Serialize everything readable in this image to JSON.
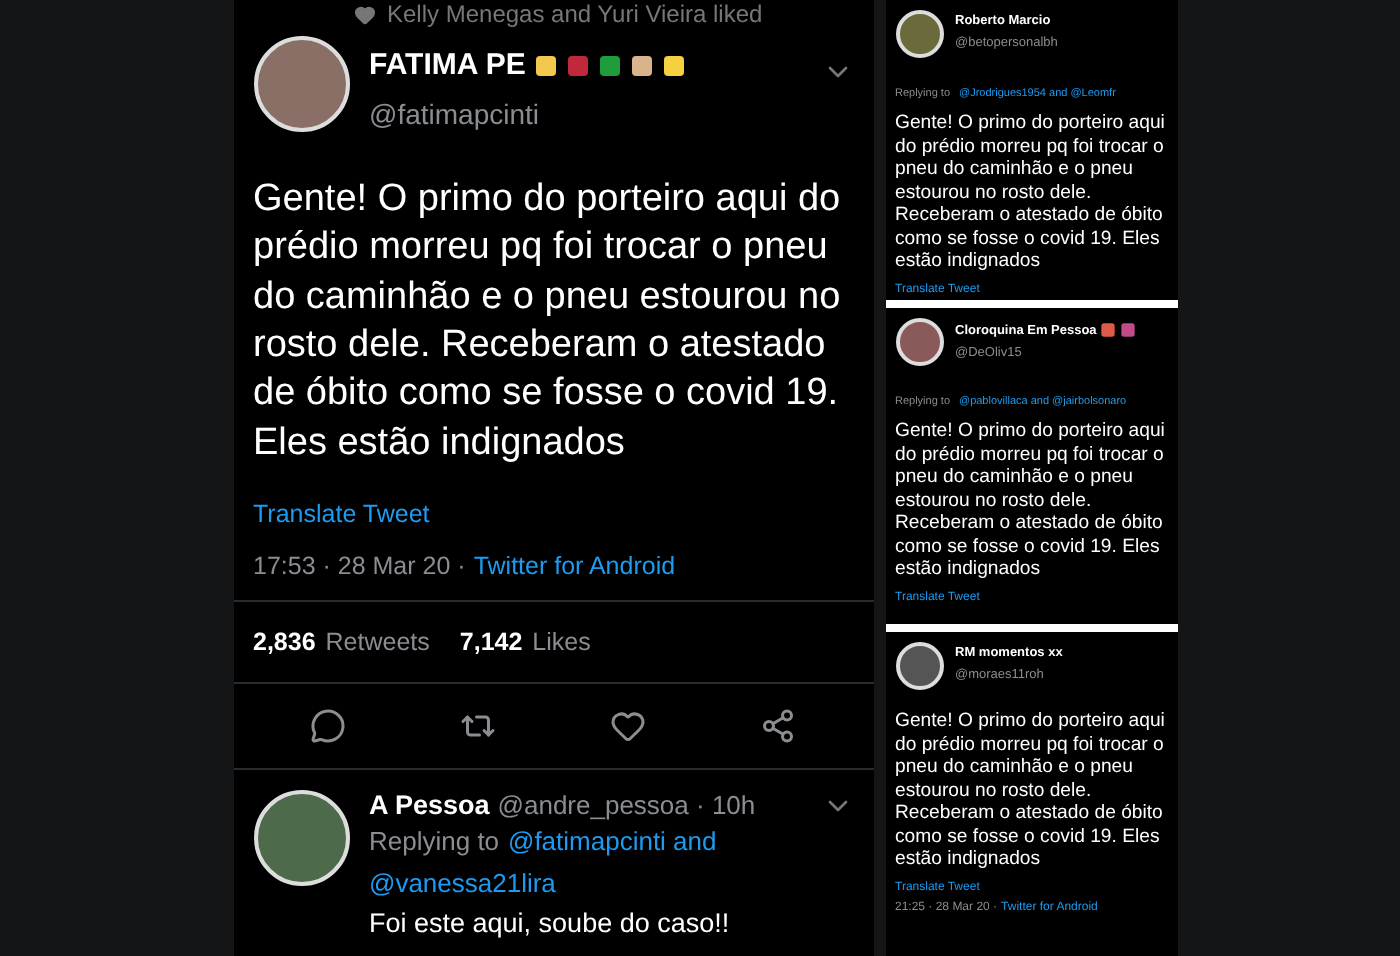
{
  "liked_banner": "Kelly Menegas and Yuri Vieira liked",
  "main_tweet": {
    "author": "FATIMA PE",
    "handle": "@fatimapcinti",
    "text": "Gente! O primo do porteiro aqui do prédio morreu pq foi trocar o pneu do caminhão e o pneu estourou no rosto dele. Receberam o atestado de óbito como se fosse o covid 19. Eles estão indignados",
    "translate": "Translate Tweet",
    "time": "17:53 · 28 Mar 20 ·",
    "source": "Twitter for Android",
    "retweets_count": "2,836",
    "retweets_label": "Retweets",
    "likes_count": "7,142",
    "likes_label": "Likes"
  },
  "reply": {
    "author": "A Pessoa",
    "handle": "@andre_pessoa · 10h",
    "replying_label": "Replying to",
    "replying_to": "@fatimapcinti and",
    "replying_to_cont": "@vanessa21lira",
    "text": "Foi este aqui, soube do caso!!"
  },
  "side_tweets": [
    {
      "author": "Roberto Marcio",
      "handle": "@betopersonalbh",
      "replying_label": "Replying to",
      "replying_to": "@Jrodrigues1954 and @Leomfr",
      "text": "Gente! O primo do porteiro aqui do prédio morreu pq foi trocar o pneu do caminhão e o pneu estourou no rosto dele. Receberam o atestado de óbito como se fosse o covid 19. Eles estão indignados",
      "translate": "Translate Tweet"
    },
    {
      "author": "Cloroquina Em Pessoa",
      "handle": "@DeOliv15",
      "replying_label": "Replying to",
      "replying_to": "@pablovillaca and @jairbolsonaro",
      "text": "Gente! O primo do porteiro aqui do prédio morreu pq foi trocar o pneu do caminhão e o pneu estourou no rosto dele. Receberam o atestado de óbito como se fosse o covid 19. Eles estão indignados",
      "translate": "Translate Tweet"
    },
    {
      "author": "RM momentos xx",
      "handle": "@moraes11roh",
      "text": "Gente! O primo do porteiro aqui do prédio morreu pq foi trocar o pneu do caminhão e o pneu estourou no rosto dele. Receberam o atestado de óbito como se fosse o covid 19. Eles estão indignados",
      "translate": "Translate Tweet",
      "time": "21:25 · 28 Mar 20 ·",
      "source": "Twitter for Android"
    }
  ]
}
